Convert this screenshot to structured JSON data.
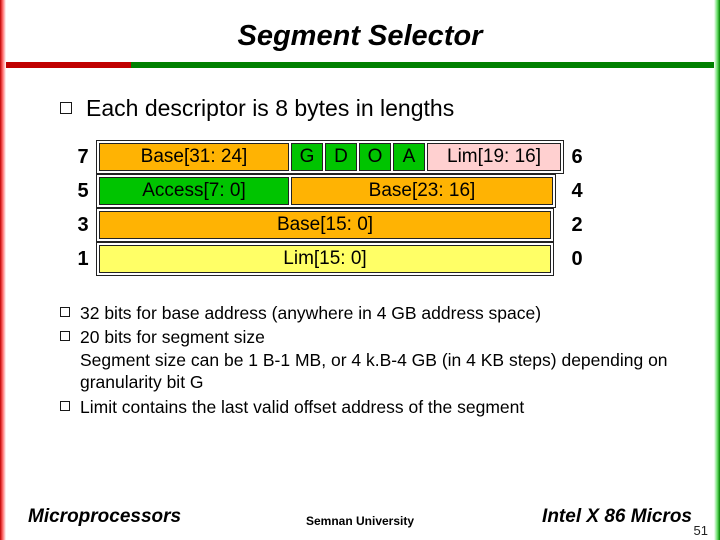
{
  "title": "Segment Selector",
  "lead_bullet": "Each descriptor is 8 bytes in lengths",
  "table": {
    "row1": {
      "left_num": "7",
      "base_hi": "Base[31: 24]",
      "g": "G",
      "d": "D",
      "o": "O",
      "a": "A",
      "lim_hi": "Lim[19: 16]",
      "right_num": "6"
    },
    "row2": {
      "left_num": "5",
      "access": "Access[7: 0]",
      "base_mid": "Base[23: 16]",
      "right_num": "4"
    },
    "row3": {
      "left_num": "3",
      "base_lo": "Base[15: 0]",
      "right_num": "2"
    },
    "row4": {
      "left_num": "1",
      "lim_lo": "Lim[15: 0]",
      "right_num": "0"
    }
  },
  "sub_bullets": {
    "b1": "32 bits for base address (anywhere in 4 GB address space)",
    "b2": "20 bits for segment size\nSegment size can be 1 B-1 MB, or 4 k.B-4 GB (in 4 KB steps) depending on granularity bit G",
    "b3": "Limit contains the last valid offset address of the segment"
  },
  "footer": {
    "left": "Microprocessors",
    "mid": "Semnan University",
    "right": "Intel X 86 Micros",
    "page": "51"
  }
}
